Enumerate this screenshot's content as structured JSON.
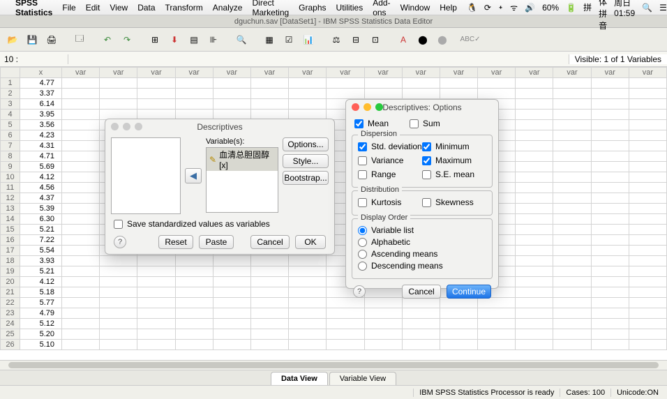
{
  "menubar": {
    "app": "SPSS Statistics",
    "items": [
      "File",
      "Edit",
      "View",
      "Data",
      "Transform",
      "Analyze",
      "Direct Marketing",
      "Graphs",
      "Utilities",
      "Add-ons",
      "Window",
      "Help"
    ],
    "right": {
      "battery": "60%",
      "ime": "简体拼音",
      "clock": "周日01:59"
    }
  },
  "window": {
    "title": "dguchun.sav [DataSet1] - IBM SPSS Statistics Data Editor"
  },
  "cellbar": {
    "ref": "10 :",
    "value": "",
    "visible": "Visible: 1 of 1 Variables"
  },
  "sheet": {
    "col_x": "x",
    "varlabel": "var",
    "rows": [
      {
        "n": 1,
        "v": "4.77"
      },
      {
        "n": 2,
        "v": "3.37"
      },
      {
        "n": 3,
        "v": "6.14"
      },
      {
        "n": 4,
        "v": "3.95"
      },
      {
        "n": 5,
        "v": "3.56"
      },
      {
        "n": 6,
        "v": "4.23"
      },
      {
        "n": 7,
        "v": "4.31"
      },
      {
        "n": 8,
        "v": "4.71"
      },
      {
        "n": 9,
        "v": "5.69"
      },
      {
        "n": 10,
        "v": "4.12"
      },
      {
        "n": 11,
        "v": "4.56"
      },
      {
        "n": 12,
        "v": "4.37"
      },
      {
        "n": 13,
        "v": "5.39"
      },
      {
        "n": 14,
        "v": "6.30"
      },
      {
        "n": 15,
        "v": "5.21"
      },
      {
        "n": 16,
        "v": "7.22"
      },
      {
        "n": 17,
        "v": "5.54"
      },
      {
        "n": 18,
        "v": "3.93"
      },
      {
        "n": 19,
        "v": "5.21"
      },
      {
        "n": 20,
        "v": "4.12"
      },
      {
        "n": 21,
        "v": "5.18"
      },
      {
        "n": 22,
        "v": "5.77"
      },
      {
        "n": 23,
        "v": "4.79"
      },
      {
        "n": 24,
        "v": "5.12"
      },
      {
        "n": 25,
        "v": "5.20"
      },
      {
        "n": 26,
        "v": "5.10"
      }
    ]
  },
  "tabs": {
    "data": "Data View",
    "variable": "Variable View"
  },
  "status": {
    "proc": "IBM SPSS Statistics Processor is ready",
    "cases": "Cases: 100",
    "unicode": "Unicode:ON"
  },
  "descriptives": {
    "title": "Descriptives",
    "variables_label": "Variable(s):",
    "variable_item": "血清总胆固醇 [x]",
    "options": "Options...",
    "style": "Style...",
    "bootstrap": "Bootstrap...",
    "save_std": "Save standardized values as variables",
    "reset": "Reset",
    "paste": "Paste",
    "cancel": "Cancel",
    "ok": "OK"
  },
  "options": {
    "title": "Descriptives: Options",
    "mean": "Mean",
    "sum": "Sum",
    "dispersion": "Dispersion",
    "std": "Std. deviation",
    "min": "Minimum",
    "variance": "Variance",
    "max": "Maximum",
    "range": "Range",
    "se": "S.E. mean",
    "distribution": "Distribution",
    "kurtosis": "Kurtosis",
    "skewness": "Skewness",
    "display_order": "Display Order",
    "varlist": "Variable list",
    "alpha": "Alphabetic",
    "asc": "Ascending means",
    "desc": "Descending means",
    "cancel": "Cancel",
    "continue": "Continue"
  }
}
